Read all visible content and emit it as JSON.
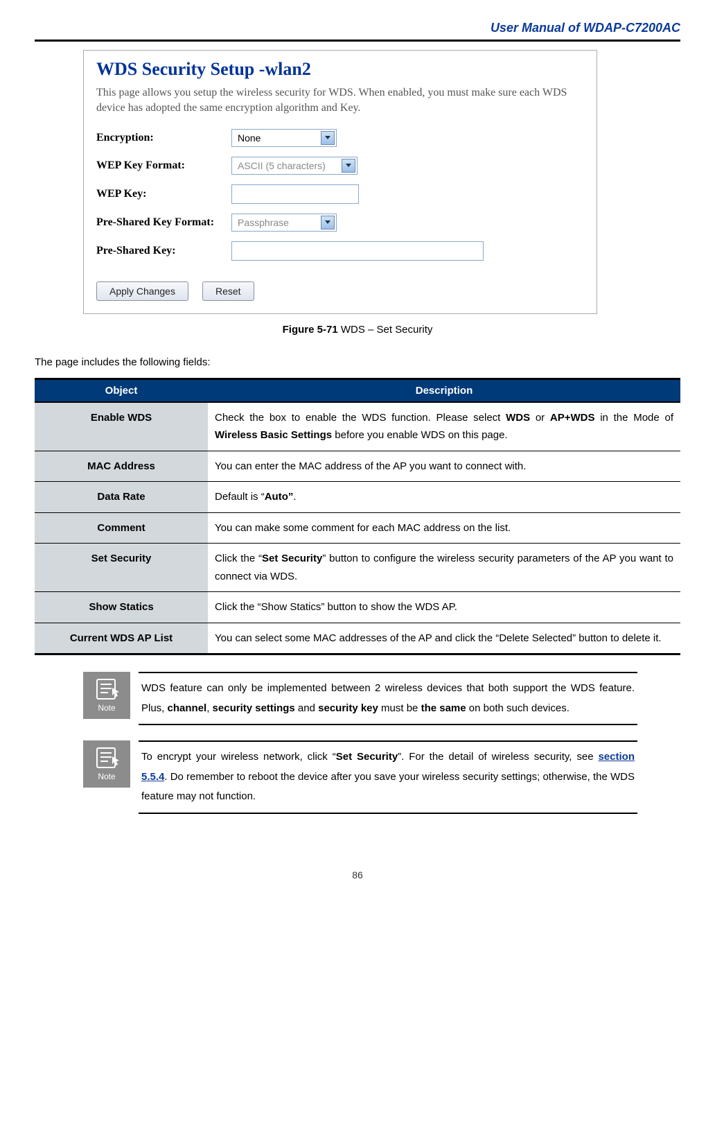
{
  "header": {
    "title": "User Manual of WDAP-C7200AC"
  },
  "screenshot": {
    "title": "WDS Security Setup -wlan2",
    "description": "This page allows you setup the wireless security for WDS. When enabled, you must make sure each WDS device has adopted the same encryption algorithm and Key.",
    "rows": {
      "encryption": {
        "label": "Encryption:",
        "value": "None"
      },
      "wepFormat": {
        "label": "WEP Key Format:",
        "value": "ASCII (5 characters)"
      },
      "wepKey": {
        "label": "WEP Key:",
        "value": ""
      },
      "pskFormat": {
        "label": "Pre-Shared Key Format:",
        "value": "Passphrase"
      },
      "psk": {
        "label": "Pre-Shared Key:",
        "value": ""
      }
    },
    "buttons": {
      "apply": "Apply Changes",
      "reset": "Reset"
    }
  },
  "figure": {
    "label": "Figure 5-71",
    "caption": " WDS – Set Security"
  },
  "intro": "The page includes the following fields:",
  "tableHeaders": {
    "object": "Object",
    "description": "Description"
  },
  "fields": [
    {
      "object": "Enable WDS",
      "description": "Check the box to enable the WDS function. Please select <b>WDS</b> or <b>AP+WDS</b> in the Mode of <b>Wireless Basic Settings</b> before you enable WDS on this page."
    },
    {
      "object": "MAC Address",
      "description": "You can enter the MAC address of the AP you want to connect with."
    },
    {
      "object": "Data Rate",
      "description": "Default is “<b>Auto”</b>."
    },
    {
      "object": "Comment",
      "description": "You can make some comment for each MAC address on the list."
    },
    {
      "object": "Set Security",
      "description": "Click the “<b>Set Security</b>” button to configure the wireless security parameters of the AP you want to connect via WDS."
    },
    {
      "object": "Show Statics",
      "description": "Click the “Show Statics” button to show the WDS AP."
    },
    {
      "object": "Current WDS AP List",
      "description": "You can select some MAC addresses of the AP and click the “Delete Selected” button to delete it."
    }
  ],
  "notes": [
    {
      "iconLabel": "Note",
      "html": "WDS feature can only be implemented between 2 wireless devices that both support the WDS feature. Plus, <b>channel</b>, <b>security settings</b> and <b>security key</b> must be <b>the same</b> on both such devices."
    },
    {
      "iconLabel": "Note",
      "html": "To encrypt your wireless network, click “<b>Set Security</b>”. For the detail of wireless security, see <a class=\"section-link\" data-name=\"section-link\" data-interactable=\"true\">section 5.5.4</a>. Do remember to reboot the device after you save your wireless security settings; otherwise, the WDS feature may not function."
    }
  ],
  "pageNumber": "86"
}
